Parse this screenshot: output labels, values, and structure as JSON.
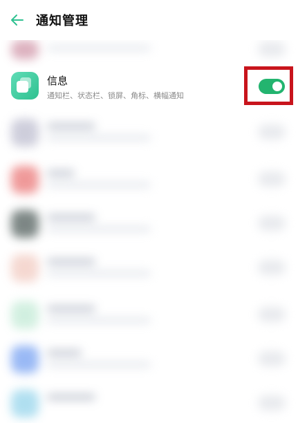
{
  "header": {
    "title": "通知管理",
    "back_icon": "arrow-left-icon",
    "back_color": "#2fc190"
  },
  "featured_app": {
    "name": "信息",
    "subtitle": "通知栏、状态栏、锁屏、角标、横幅通知",
    "icon": "messages-app-icon",
    "icon_color": "#3cc99b",
    "toggle_on": true,
    "toggle_color": "#23b46f",
    "highlight_color": "#c8141c"
  }
}
